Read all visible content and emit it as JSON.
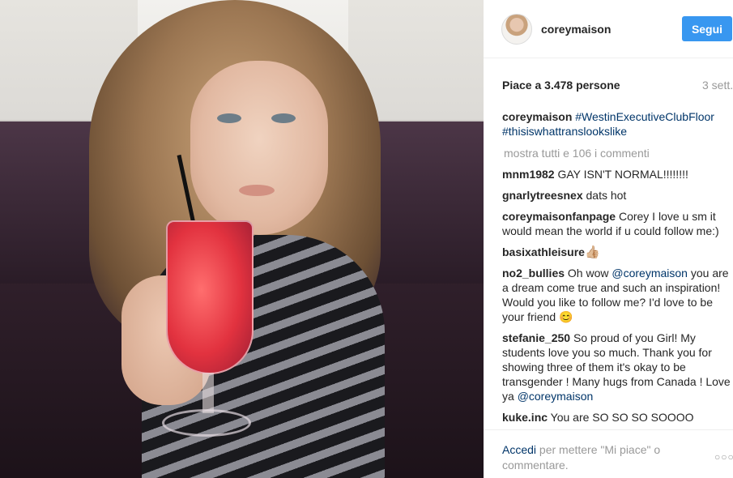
{
  "header": {
    "username": "coreymaison",
    "follow_label": "Segui"
  },
  "post": {
    "likes": "Piace a 3.478 persone",
    "date": "3 sett."
  },
  "caption": {
    "user": "coreymaison",
    "tag1": "#WestinExecutiveClubFloor",
    "tag2": "#thisiswhattranslookslike"
  },
  "load_more": "mostra tutti e 106 i commenti",
  "comments": [
    {
      "user": "mnm1982",
      "text": " GAY ISN'T NORMAL!!!!!!!!"
    },
    {
      "user": "gnarlytreesnex",
      "text": " dats hot"
    },
    {
      "user": "coreymaisonfanpage",
      "text": " Corey I love u sm it would mean the world if u could follow me:)"
    },
    {
      "user": "basixathleisure",
      "text": " 👍🏼"
    },
    {
      "user": "no2_bullies",
      "text_before": " Oh wow ",
      "mention": "@coreymaison",
      "text_after": " you are a dream come true and such an inspiration! Would you like to follow me? I'd love to be your friend 😊"
    },
    {
      "user": "stefanie_250",
      "text_before": " So proud of you Girl! My students love you so much. Thank you for showing three of them it's okay to be transgender ! Many hugs from Canada ! Love ya ",
      "mention": "@coreymaison"
    },
    {
      "user": "kuke.inc",
      "text": " You are SO SO SO SOOOO"
    }
  ],
  "footer": {
    "login_link": "Accedi",
    "login_text": " per mettere \"Mi piace\" o commentare.",
    "more_icon": "ellipsis-icon",
    "more_glyph": "○○○"
  },
  "colors": {
    "accent": "#3897f0",
    "link": "#003569",
    "muted": "#999999"
  }
}
